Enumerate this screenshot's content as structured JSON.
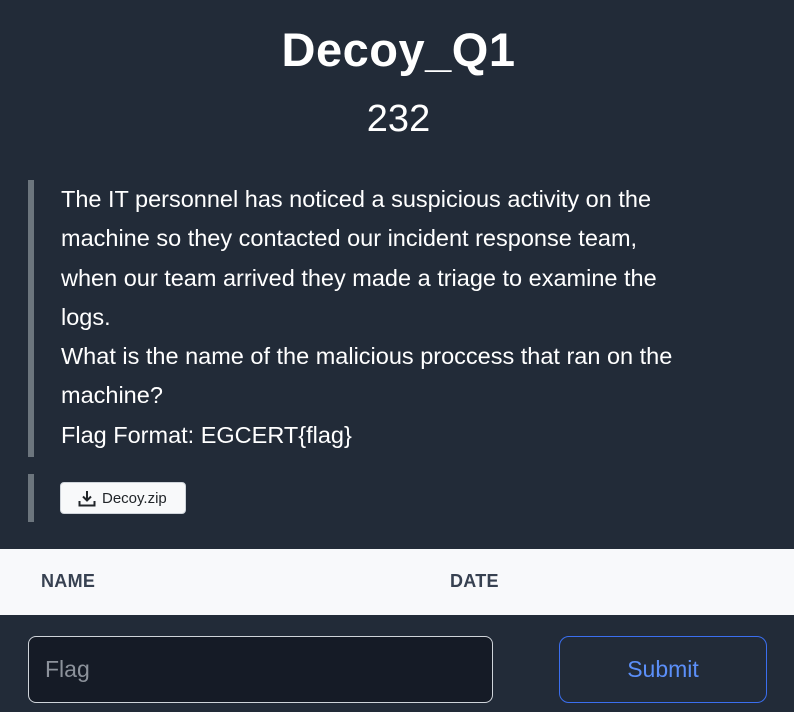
{
  "challenge": {
    "title": "Decoy_Q1",
    "points": "232",
    "description_lines": [
      "The IT personnel has noticed a suspicious activity on the",
      "machine so they contacted our incident response team,",
      "when our team arrived they made a triage to examine the",
      "logs.",
      "What is the name of the malicious proccess that ran on the",
      "machine?",
      "Flag Format: EGCERT{flag}"
    ],
    "file": {
      "name": "Decoy.zip",
      "icon": "download-icon"
    }
  },
  "solves_table": {
    "columns": [
      "NAME",
      "DATE"
    ]
  },
  "submission": {
    "placeholder": "Flag",
    "submit_label": "Submit"
  },
  "colors": {
    "background": "#222b38",
    "accent": "#3b6ff0",
    "table_header_bg": "#f8f9fb"
  }
}
